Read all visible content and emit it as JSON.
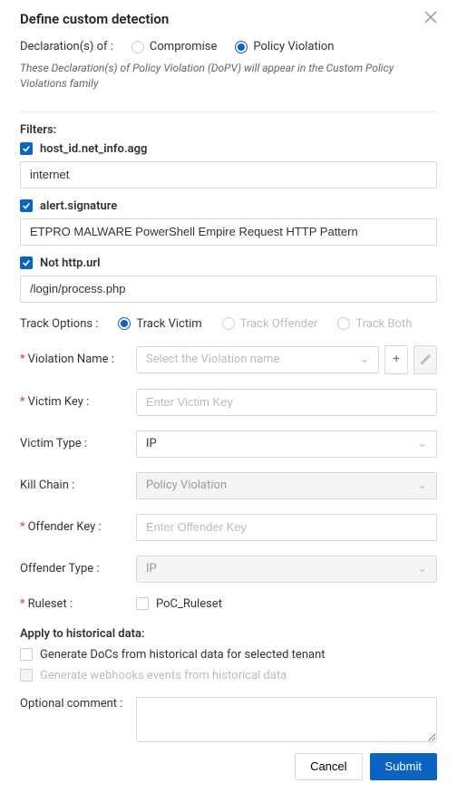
{
  "title": "Define custom detection",
  "declarations": {
    "label": "Declaration(s) of :",
    "options": {
      "compromise": "Compromise",
      "policy": "Policy Violation"
    },
    "selected": "policy",
    "hint": "These Declaration(s) of Policy Violation (DoPV) will appear in the Custom Policy Violations family"
  },
  "filters": {
    "label": "Filters:",
    "items": [
      {
        "name": "host_id.net_info.agg",
        "value": "internet"
      },
      {
        "name": "alert.signature",
        "value": "ETPRO MALWARE PowerShell Empire Request HTTP Pattern"
      },
      {
        "name": "Not http.url",
        "value": "/login/process.php"
      }
    ]
  },
  "track": {
    "label": "Track Options :",
    "victim": "Track Victim",
    "offender": "Track Offender",
    "both": "Track Both"
  },
  "violation_name": {
    "label": "Violation Name :",
    "placeholder": "Select the Violation name",
    "plus": "+"
  },
  "victim_key": {
    "label": "Victim Key :",
    "placeholder": "Enter Victim Key"
  },
  "victim_type": {
    "label": "Victim Type :",
    "value": "IP"
  },
  "kill_chain": {
    "label": "Kill Chain :",
    "value": "Policy Violation"
  },
  "offender_key": {
    "label": "Offender Key :",
    "placeholder": "Enter Offender Key"
  },
  "offender_type": {
    "label": "Offender Type :",
    "value": "IP"
  },
  "ruleset": {
    "label": "Ruleset :",
    "option": "PoC_Ruleset"
  },
  "historical": {
    "label": "Apply to historical data:",
    "generate_docs": "Generate DoCs from historical data for selected tenant",
    "generate_webhooks": "Generate webhooks events from historical data"
  },
  "comment": {
    "label": "Optional comment :"
  },
  "buttons": {
    "cancel": "Cancel",
    "submit": "Submit"
  }
}
